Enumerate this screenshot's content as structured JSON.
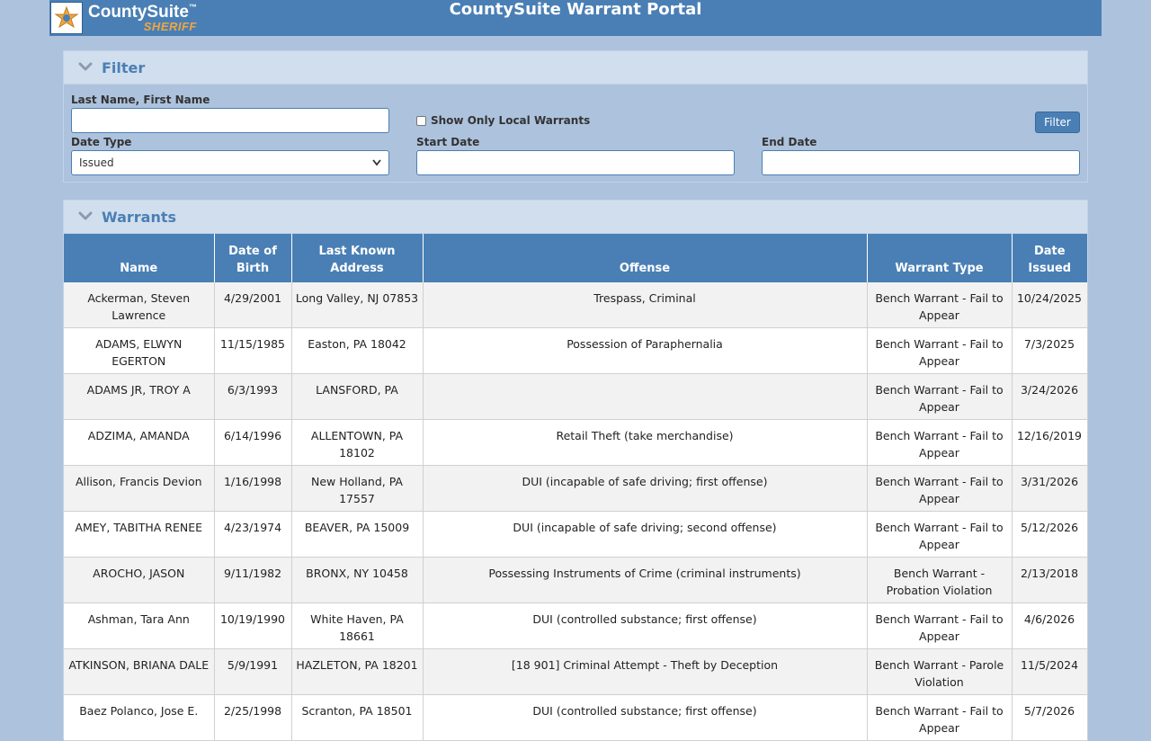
{
  "header": {
    "logo_main": "CountySuite",
    "logo_tm": "™",
    "logo_sub": "SHERIFF",
    "title": "CountySuite Warrant Portal"
  },
  "filter": {
    "title": "Filter",
    "name_label": "Last Name, First Name",
    "name_value": "",
    "local_label": "Show Only Local Warrants",
    "local_checked": false,
    "filter_button": "Filter",
    "date_type_label": "Date Type",
    "date_type_value": "Issued",
    "start_label": "Start Date",
    "start_value": "",
    "end_label": "End Date",
    "end_value": ""
  },
  "warrants": {
    "title": "Warrants",
    "columns": [
      "Name",
      "Date of Birth",
      "Last Known Address",
      "Offense",
      "Warrant Type",
      "Date Issued"
    ],
    "rows": [
      [
        "Ackerman, Steven Lawrence",
        "4/29/2001",
        "Long Valley, NJ 07853",
        "Trespass, Criminal",
        "Bench Warrant - Fail to Appear",
        "10/24/2025"
      ],
      [
        "ADAMS, ELWYN EGERTON",
        "11/15/1985",
        "Easton, PA 18042",
        "Possession of Paraphernalia",
        "Bench Warrant - Fail to Appear",
        "7/3/2025"
      ],
      [
        "ADAMS JR, TROY A",
        "6/3/1993",
        "LANSFORD, PA",
        "",
        "Bench Warrant - Fail to Appear",
        "3/24/2026"
      ],
      [
        "ADZIMA, AMANDA",
        "6/14/1996",
        "ALLENTOWN, PA 18102",
        "Retail Theft (take merchandise)",
        "Bench Warrant - Fail to Appear",
        "12/16/2019"
      ],
      [
        "Allison, Francis Devion",
        "1/16/1998",
        "New Holland, PA 17557",
        "DUI (incapable of safe driving; first offense)",
        "Bench Warrant - Fail to Appear",
        "3/31/2026"
      ],
      [
        "AMEY, TABITHA RENEE",
        "4/23/1974",
        "BEAVER, PA 15009",
        "DUI (incapable of safe driving; second offense)",
        "Bench Warrant - Fail to Appear",
        "5/12/2026"
      ],
      [
        "AROCHO, JASON",
        "9/11/1982",
        "BRONX, NY 10458",
        "Possessing Instruments of Crime (criminal instruments)",
        "Bench Warrant - Probation Violation",
        "2/13/2018"
      ],
      [
        "Ashman, Tara Ann",
        "10/19/1990",
        "White Haven, PA 18661",
        "DUI (controlled substance; first offense)",
        "Bench Warrant - Fail to Appear",
        "4/6/2026"
      ],
      [
        "ATKINSON, BRIANA DALE",
        "5/9/1991",
        "HAZLETON, PA 18201",
        "[18 901] Criminal Attempt - Theft by Deception",
        "Bench Warrant - Parole Violation",
        "11/5/2024"
      ],
      [
        "Baez Polanco, Jose E.",
        "2/25/1998",
        "Scranton, PA 18501",
        "DUI (controlled substance; first offense)",
        "Bench Warrant - Fail to Appear",
        "5/7/2026"
      ]
    ]
  },
  "icons": {
    "logo": "sheriff-star-icon",
    "collapse": "chevron-down-icon",
    "select": "select-arrow-icon"
  },
  "colors": {
    "header": "#4a7fb5",
    "background": "#adc2dd",
    "accent_logo": "#f0a640"
  }
}
